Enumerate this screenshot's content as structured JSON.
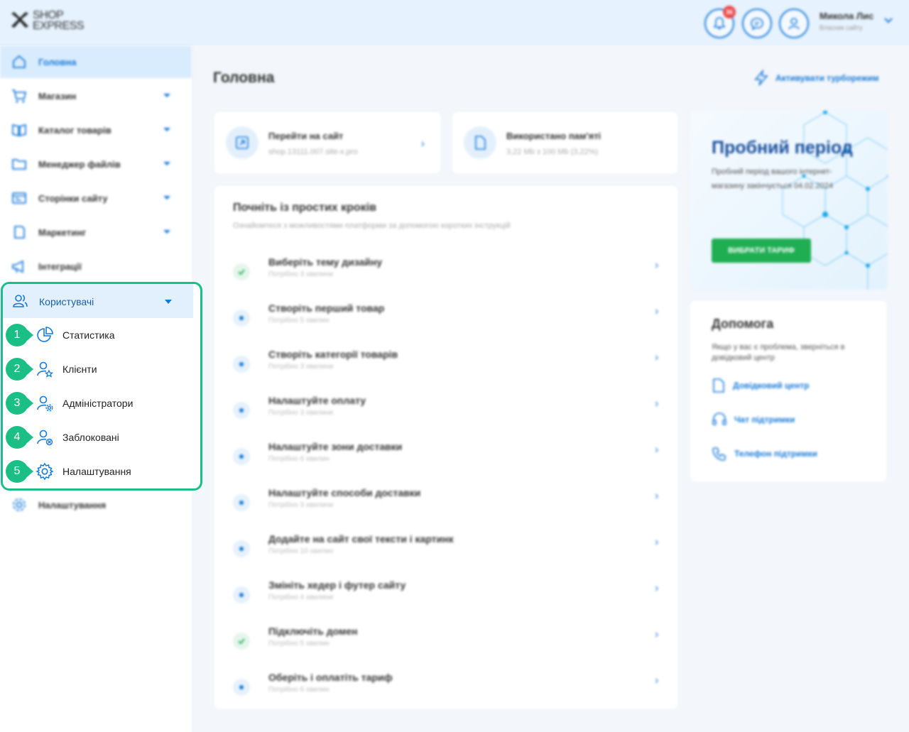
{
  "brand": {
    "line1": "SHOP",
    "line2": "EXPRESS"
  },
  "header": {
    "notifications_count": "36",
    "user_name": "Микола Лис",
    "user_role": "Власник сайту"
  },
  "sidebar": {
    "items": [
      {
        "label": "Головна",
        "icon": "home-icon"
      },
      {
        "label": "Магазин",
        "icon": "cart-icon"
      },
      {
        "label": "Каталог товарів",
        "icon": "catalog-icon"
      },
      {
        "label": "Менеджер файлів",
        "icon": "folder-icon"
      },
      {
        "label": "Сторінки сайту",
        "icon": "pages-icon"
      },
      {
        "label": "Маркетинг",
        "icon": "marketing-icon"
      },
      {
        "label": "Інтеграції",
        "icon": "megaphone-icon"
      }
    ],
    "users": {
      "label": "Користувачі",
      "sub_items": [
        {
          "num": "1",
          "label": "Статистика",
          "icon": "pie-chart-icon"
        },
        {
          "num": "2",
          "label": "Клієнти",
          "icon": "user-star-icon"
        },
        {
          "num": "3",
          "label": "Адміністратори",
          "icon": "user-gear-icon"
        },
        {
          "num": "4",
          "label": "Заблоковані",
          "icon": "user-blocked-icon"
        },
        {
          "num": "5",
          "label": "Налаштування",
          "icon": "gear-icon"
        }
      ]
    },
    "settings_label": "Налаштування"
  },
  "main": {
    "title": "Головна",
    "turbo_label": "Активувати турборежим",
    "quick_cards": [
      {
        "title": "Перейти на сайт",
        "subtitle": "shop.13111.007.site-x.pro"
      },
      {
        "title": "Використано пам'яті",
        "subtitle": "3,22 Mb з 100 Mb (3,22%)"
      }
    ],
    "steps": {
      "title": "Почніть із простих кроків",
      "subtitle": "Ознайомтеся з можливостями платформи за допомогою коротких інструкцій",
      "items": [
        {
          "title": "Виберіть тему дизайну",
          "time": "Потрібно 3 хвилини",
          "done": true
        },
        {
          "title": "Створіть перший товар",
          "time": "Потрібно 5 хвилин",
          "done": false
        },
        {
          "title": "Створіть категорії товарів",
          "time": "Потрібно 3 хвилини",
          "done": false
        },
        {
          "title": "Налаштуйте оплату",
          "time": "Потрібно 3 хвилини",
          "done": false
        },
        {
          "title": "Налаштуйте зони доставки",
          "time": "Потрібно 6 хвилин",
          "done": false
        },
        {
          "title": "Налаштуйте способи доставки",
          "time": "Потрібно 3 хвилини",
          "done": false
        },
        {
          "title": "Додайте на сайт свої тексти і картинк",
          "time": "Потрібно 10 хвилин",
          "done": false
        },
        {
          "title": "Змініть хедер і футер сайту",
          "time": "Потрібно 4 хвилини",
          "done": false
        },
        {
          "title": "Підключіть домен",
          "time": "Потрібно 5 хвилин",
          "done": true
        },
        {
          "title": "Оберіть і оплатіть тариф",
          "time": "Потрібно 6 хвилин",
          "done": false
        }
      ]
    },
    "trial": {
      "title": "Пробний період",
      "text": "Пробний період вашого інтернет-магазину закінчується 04.02.2024",
      "button": "ВИБРАТИ ТАРИФ"
    },
    "help": {
      "title": "Допомога",
      "text": "Якщо у вас є проблема, зверніться в довідковий центр",
      "links": [
        {
          "label": "Довідковий центр",
          "icon": "document-icon"
        },
        {
          "label": "Чат підтримки",
          "icon": "headset-icon"
        },
        {
          "label": "Телефон підтримки",
          "icon": "phone-icon"
        }
      ]
    }
  },
  "colors": {
    "accent": "#1679d8",
    "highlight": "#1bbf86",
    "button_green": "#1fae52"
  }
}
